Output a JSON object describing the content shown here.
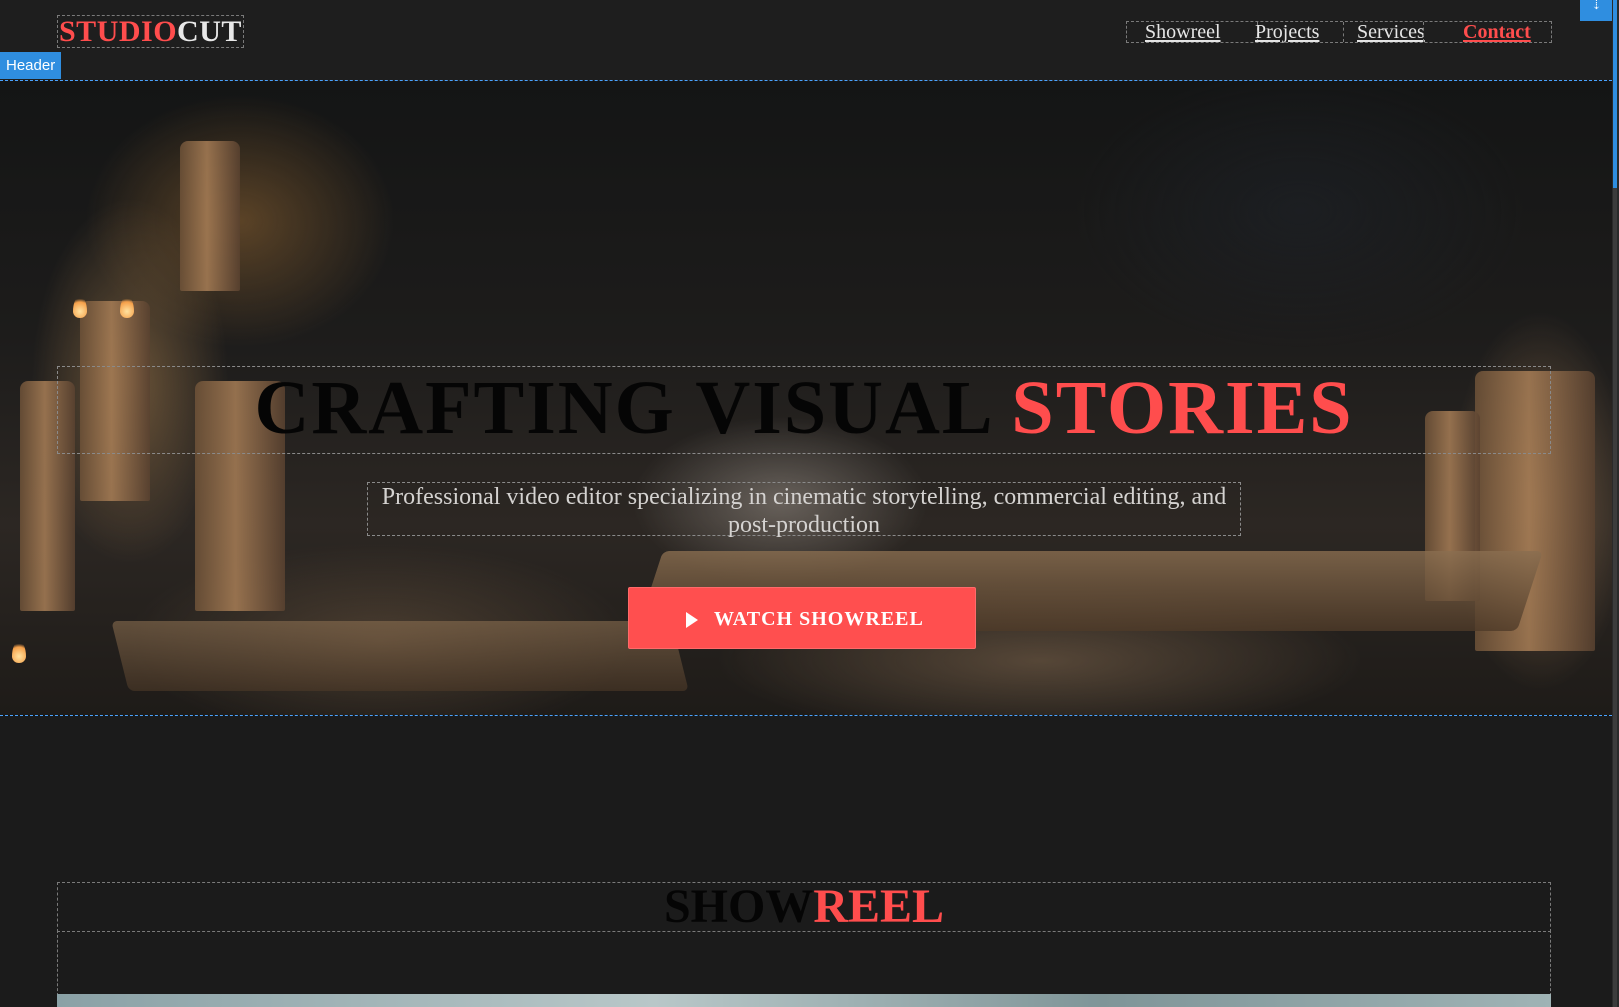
{
  "header": {
    "logo": {
      "part1": "STUDIO",
      "part2": "CUT"
    },
    "nav": [
      {
        "label": "Showreel"
      },
      {
        "label": "Projects"
      },
      {
        "label": "Services"
      },
      {
        "label": "Contact"
      }
    ],
    "editor_tag": "Header"
  },
  "hero": {
    "headline_dark": "CRAFTING VISUAL ",
    "headline_accent": "STORIES",
    "subtitle": "Professional video editor specializing in cinematic storytelling, commercial editing, and post-production",
    "cta_label": "WATCH SHOWREEL"
  },
  "showreel": {
    "title_dark": "SHOW",
    "title_accent": "REEL"
  },
  "colors": {
    "accent": "#ff4d4d",
    "background": "#1b1b1b",
    "editor_blue": "#2f8ee0"
  },
  "icons": {
    "cta": "play-icon",
    "handle": "move-handle-icon"
  }
}
